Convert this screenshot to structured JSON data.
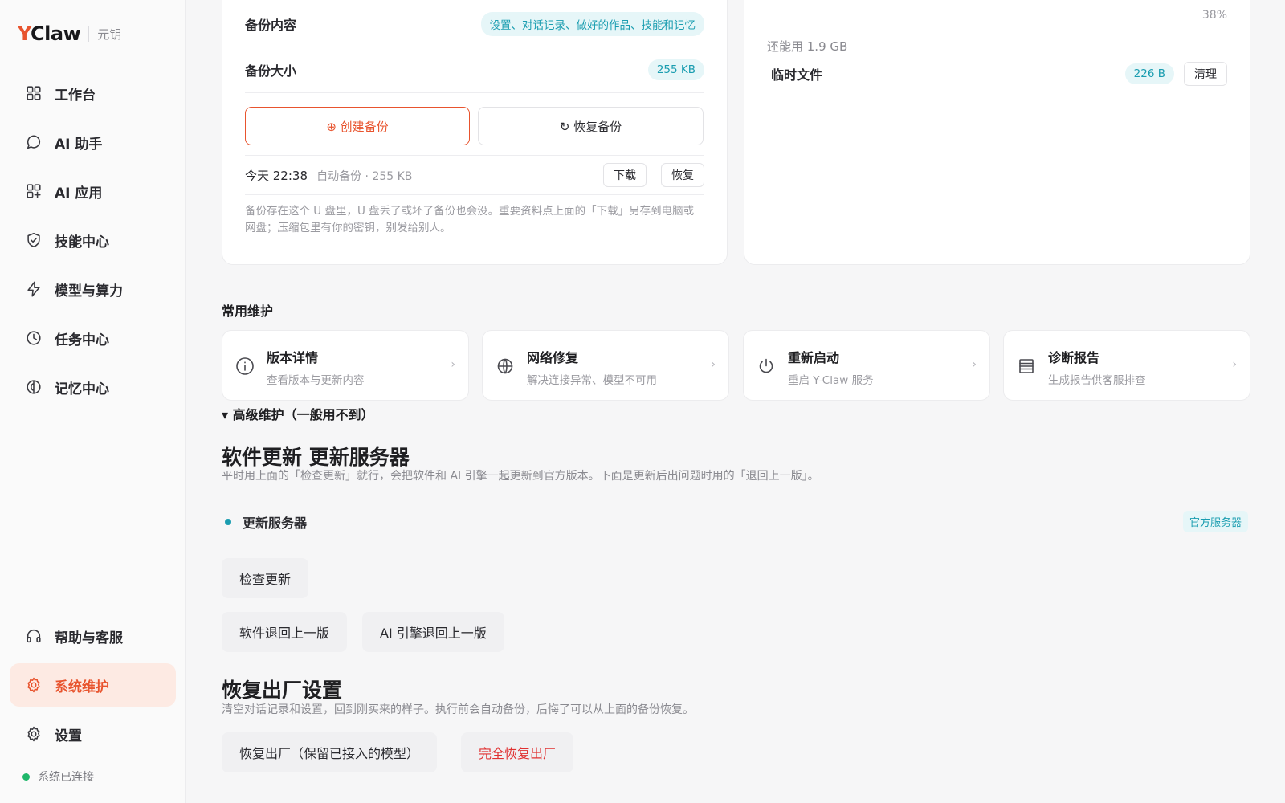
{
  "brand": {
    "logo_y": "Y",
    "logo_rest": "Claw",
    "sub": "元钥"
  },
  "nav_top": [
    {
      "label": "工作台",
      "icon": "grid-icon"
    },
    {
      "label": "AI 助手",
      "icon": "chat-icon"
    },
    {
      "label": "AI 应用",
      "icon": "apps-icon"
    },
    {
      "label": "技能中心",
      "icon": "shield-icon"
    },
    {
      "label": "模型与算力",
      "icon": "bolt-icon"
    },
    {
      "label": "任务中心",
      "icon": "clock-icon"
    },
    {
      "label": "记忆中心",
      "icon": "memory-icon"
    }
  ],
  "nav_bottom": [
    {
      "label": "帮助与客服",
      "icon": "headset-icon",
      "active": false
    },
    {
      "label": "系统维护",
      "icon": "gear-icon",
      "active": true
    },
    {
      "label": "设置",
      "icon": "gear-icon",
      "active": false
    }
  ],
  "status": {
    "text": "系统已连接"
  },
  "backup": {
    "content_label": "备份内容",
    "content_value": "设置、对话记录、做好的作品、技能和记忆",
    "size_label": "备份大小",
    "size_value": "255 KB",
    "create_label": "⊕ 创建备份",
    "restore_label": "↻ 恢复备份",
    "history_time": "今天 22:38",
    "history_meta": "自动备份 · 255 KB",
    "download_label": "下载",
    "restore_small_label": "恢复",
    "note": "备份存在这个 U 盘里，U 盘丢了或坏了备份也会没。重要资料点上面的「下载」另存到电脑或网盘；压缩包里有你的密钥，别发给别人。"
  },
  "storage": {
    "percent": "38%",
    "remaining": "还能用 1.9 GB",
    "temp_label": "临时文件",
    "temp_value": "226 B",
    "clean_label": "清理"
  },
  "maintenance": {
    "title": "常用维护",
    "cards": [
      {
        "title": "版本详情",
        "desc": "查看版本与更新内容",
        "icon": "info-icon"
      },
      {
        "title": "网络修复",
        "desc": "解决连接异常、模型不可用",
        "icon": "globe-icon"
      },
      {
        "title": "重新启动",
        "desc": "重启 Y-Claw 服务",
        "icon": "power-icon"
      },
      {
        "title": "诊断报告",
        "desc": "生成报告供客服排查",
        "icon": "report-icon"
      }
    ],
    "chevron": "›"
  },
  "advanced": {
    "toggle": "▾ 高级维护（一般用不到）",
    "update_title": "软件更新 更新服务器",
    "update_desc": "平时用上面的「检查更新」就行，会把软件和 AI 引擎一起更新到官方版本。下面是更新后出问题时用的「退回上一版」。",
    "server_label": "更新服务器",
    "server_tag": "官方服务器",
    "check_label": "检查更新",
    "rollback_sw": "软件退回上一版",
    "rollback_ai": "AI 引擎退回上一版",
    "factory_title": "恢复出厂设置",
    "factory_desc": "清空对话记录和设置，回到刚买来的样子。执行前会自动备份，后悔了可以从上面的备份恢复。",
    "factory_keep": "恢复出厂（保留已接入的模型）",
    "factory_full": "完全恢复出厂"
  },
  "colors": {
    "accent": "#e8542e",
    "teal": "#1a9db0",
    "danger": "#e03131",
    "connected": "#1fb76a"
  }
}
